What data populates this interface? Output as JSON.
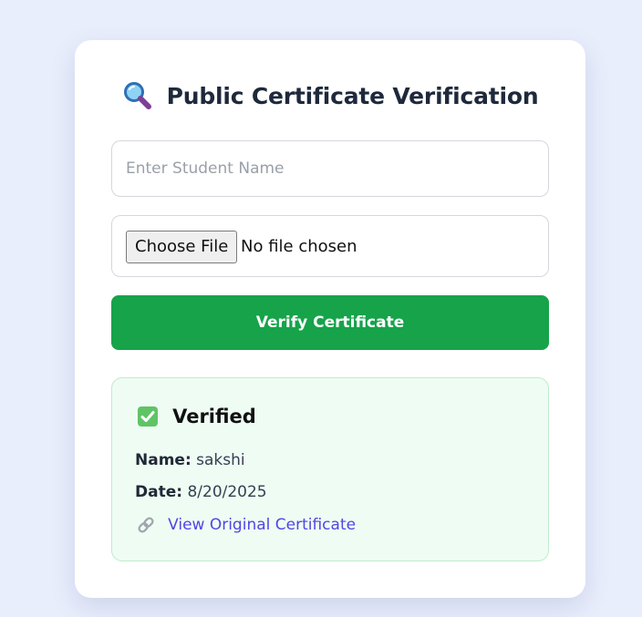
{
  "page": {
    "title": "Public Certificate Verification",
    "title_icon": "magnifying-glass-icon"
  },
  "form": {
    "name_placeholder": "Enter Student Name",
    "name_value": "",
    "file_button_label": "Choose File",
    "file_status": "No file chosen",
    "verify_button_label": "Verify Certificate"
  },
  "result": {
    "status_icon": "check-mark-icon",
    "status_text": "Verified",
    "name_label": "Name:",
    "name_value": "sakshi",
    "date_label": "Date:",
    "date_value": "8/20/2025",
    "link_icon": "link-icon",
    "link_text": "View Original Certificate"
  },
  "colors": {
    "background": "#e9eefc",
    "card": "#ffffff",
    "primary_button": "#16a34a",
    "result_background": "#effcf3",
    "result_border": "#bfeccd",
    "link": "#4f46e5"
  }
}
